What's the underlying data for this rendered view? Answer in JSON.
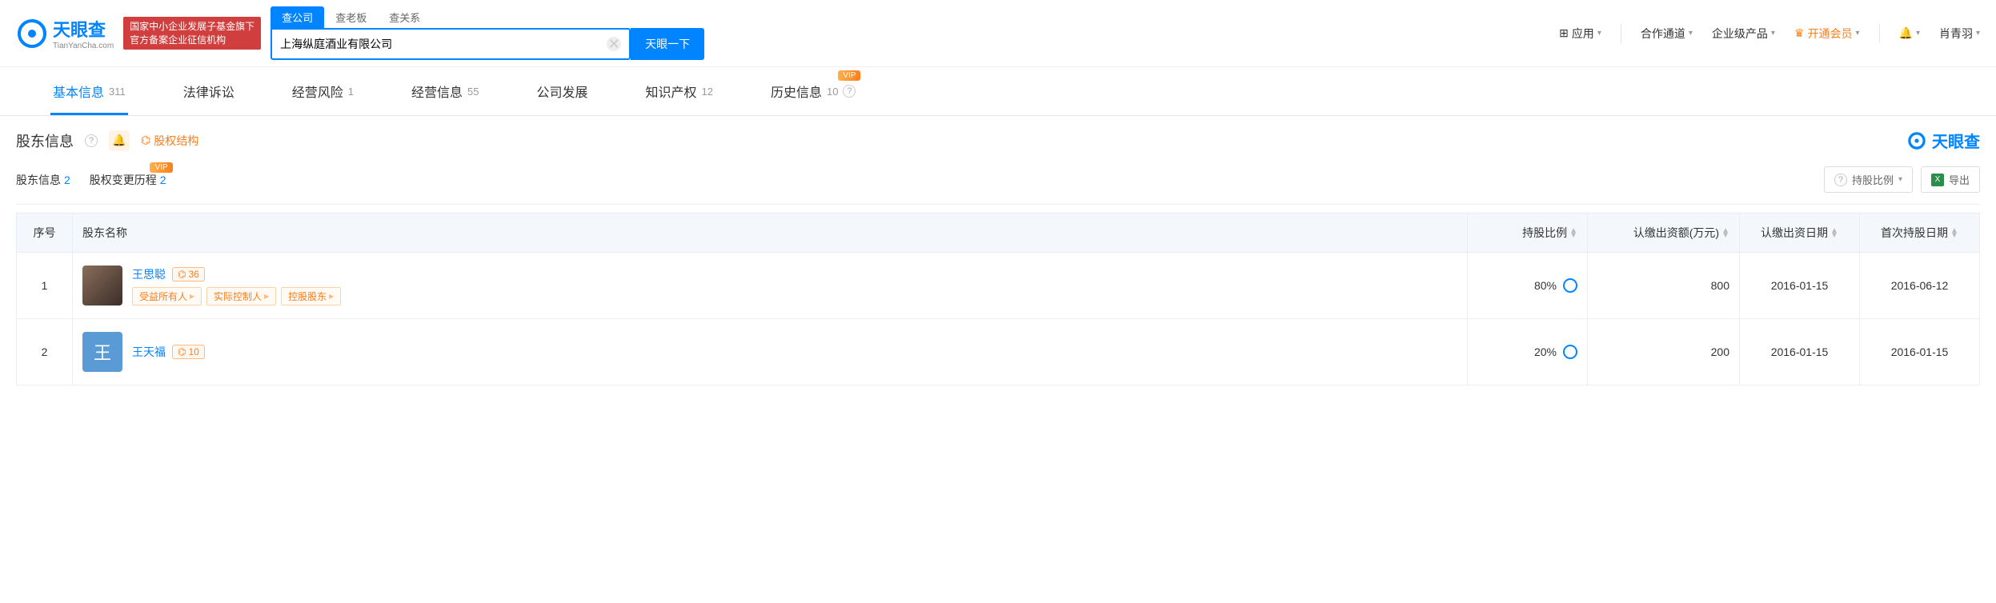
{
  "logo": {
    "cn": "天眼查",
    "en": "TianYanCha.com"
  },
  "header_badge": "国家中小企业发展子基金旗下\n官方备案企业征信机构",
  "search": {
    "tabs": [
      "查公司",
      "查老板",
      "查关系"
    ],
    "value": "上海纵庭酒业有限公司",
    "button": "天眼一下"
  },
  "top_nav": {
    "apps": "应用",
    "coop": "合作通道",
    "enterprise": "企业级产品",
    "vip": "开通会员",
    "user": "肖青羽"
  },
  "main_tabs": [
    {
      "label": "基本信息",
      "count": "311",
      "active": true
    },
    {
      "label": "法律诉讼",
      "count": ""
    },
    {
      "label": "经营风险",
      "count": "1"
    },
    {
      "label": "经营信息",
      "count": "55"
    },
    {
      "label": "公司发展",
      "count": ""
    },
    {
      "label": "知识产权",
      "count": "12"
    },
    {
      "label": "历史信息",
      "count": "10",
      "vip": true,
      "help": true
    }
  ],
  "section": {
    "title": "股东信息",
    "struct_btn": "股权结构",
    "brand": "天眼查"
  },
  "sub_tabs": [
    {
      "label": "股东信息",
      "count": "2",
      "active": true
    },
    {
      "label": "股权变更历程",
      "count": "2",
      "vip": true
    }
  ],
  "tools": {
    "ratio": "持股比例",
    "export": "导出"
  },
  "columns": {
    "idx": "序号",
    "name": "股东名称",
    "ratio": "持股比例",
    "amount": "认缴出资额(万元)",
    "sub_date": "认缴出资日期",
    "first_date": "首次持股日期"
  },
  "rows": [
    {
      "idx": "1",
      "name": "王思聪",
      "rel_count": "36",
      "tags": [
        "受益所有人",
        "实际控制人",
        "控股股东"
      ],
      "ratio": "80%",
      "amount": "800",
      "sub_date": "2016-01-15",
      "first_date": "2016-06-12",
      "avatar_type": "img"
    },
    {
      "idx": "2",
      "name": "王天福",
      "rel_count": "10",
      "tags": [],
      "ratio": "20%",
      "amount": "200",
      "sub_date": "2016-01-15",
      "first_date": "2016-01-15",
      "avatar_type": "blue",
      "avatar_char": "王"
    }
  ]
}
